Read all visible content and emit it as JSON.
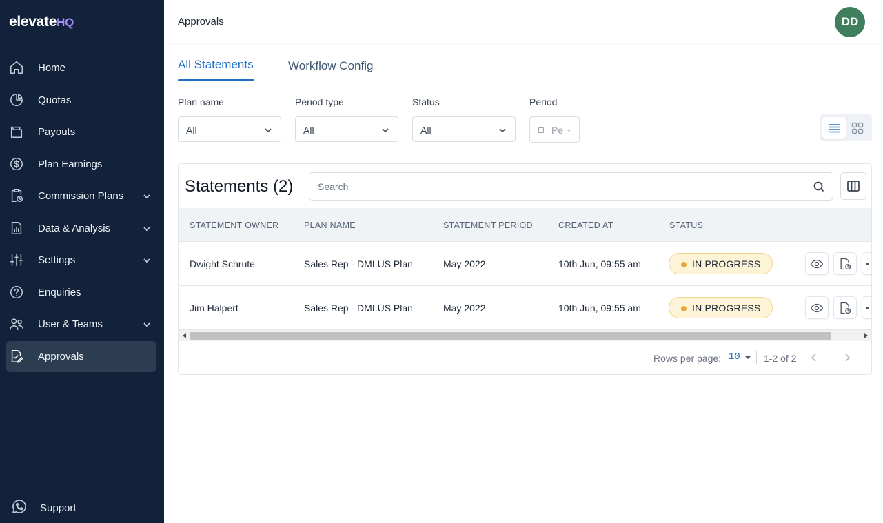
{
  "app": {
    "logo_main": "elevate",
    "logo_accent": "HQ"
  },
  "sidebar": {
    "items": [
      {
        "label": "Home",
        "icon": "home-icon",
        "has_chevron": false
      },
      {
        "label": "Quotas",
        "icon": "pie-chart-icon",
        "has_chevron": false
      },
      {
        "label": "Payouts",
        "icon": "wallet-icon",
        "has_chevron": false
      },
      {
        "label": "Plan Earnings",
        "icon": "dollar-circle-icon",
        "has_chevron": false
      },
      {
        "label": "Commission Plans",
        "icon": "clipboard-clock-icon",
        "has_chevron": true
      },
      {
        "label": "Data & Analysis",
        "icon": "document-chart-icon",
        "has_chevron": true
      },
      {
        "label": "Settings",
        "icon": "sliders-icon",
        "has_chevron": true
      },
      {
        "label": "Enquiries",
        "icon": "question-circle-icon",
        "has_chevron": false
      },
      {
        "label": "User & Teams",
        "icon": "users-icon",
        "has_chevron": true
      },
      {
        "label": "Approvals",
        "icon": "document-check-icon",
        "has_chevron": false,
        "active": true
      }
    ],
    "support_label": "Support"
  },
  "header": {
    "title": "Approvals",
    "avatar_initials": "DD",
    "avatar_color": "#3f7f5e"
  },
  "tabs": {
    "active": "All Statements",
    "inactive": "Workflow Config"
  },
  "filters": {
    "plan_name": {
      "label": "Plan name",
      "value": "All"
    },
    "period_type": {
      "label": "Period type",
      "value": "All"
    },
    "status": {
      "label": "Status",
      "value": "All"
    },
    "period": {
      "label": "Period",
      "placeholder": "Per"
    }
  },
  "statements": {
    "title": "Statements (2)",
    "search_placeholder": "Search",
    "columns": [
      "STATEMENT OWNER",
      "PLAN NAME",
      "STATEMENT PERIOD",
      "CREATED AT",
      "STATUS"
    ],
    "rows": [
      {
        "owner": "Dwight Schrute",
        "plan": "Sales Rep - DMI US Plan",
        "period": "May 2022",
        "created": "10th Jun, 09:55 am",
        "status": "IN PROGRESS"
      },
      {
        "owner": "Jim Halpert",
        "plan": "Sales Rep - DMI US Plan",
        "period": "May 2022",
        "created": "10th Jun, 09:55 am",
        "status": "IN PROGRESS"
      }
    ]
  },
  "pagination": {
    "rows_per_page_label": "Rows per page:",
    "rows_per_page_value": "10",
    "range": "1-2 of 2"
  },
  "colors": {
    "sidebar_bg": "#11223a",
    "accent": "#1f6fc5",
    "badge_bg": "#fdf4d8",
    "badge_dot": "#e8a93a"
  }
}
